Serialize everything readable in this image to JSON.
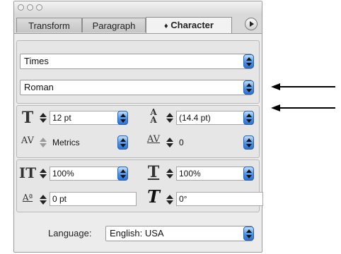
{
  "tabs": [
    "Transform",
    "Paragraph",
    "Character"
  ],
  "active_tab_prefix": "♦",
  "font": {
    "family": "Times",
    "style": "Roman"
  },
  "fields": {
    "font_size": "12 pt",
    "leading": "(14.4 pt)",
    "kerning": "Metrics",
    "tracking": "0",
    "vertical_scale": "100%",
    "horizontal_scale": "100%",
    "baseline_shift": "0 pt",
    "skew": "0°"
  },
  "language": {
    "label": "Language:",
    "value": "English: USA"
  },
  "icons": {
    "font_size": "font-size-icon",
    "leading": "leading-icon",
    "kerning": "kerning-icon",
    "tracking": "tracking-icon",
    "vertical_scale": "vertical-scale-icon",
    "horizontal_scale": "horizontal-scale-icon",
    "baseline_shift": "baseline-shift-icon",
    "skew": "skew-icon",
    "palette_menu": "palette-menu-icon"
  },
  "colors": {
    "popup_blue": "#4a92e6",
    "panel_bg": "#ececec"
  }
}
